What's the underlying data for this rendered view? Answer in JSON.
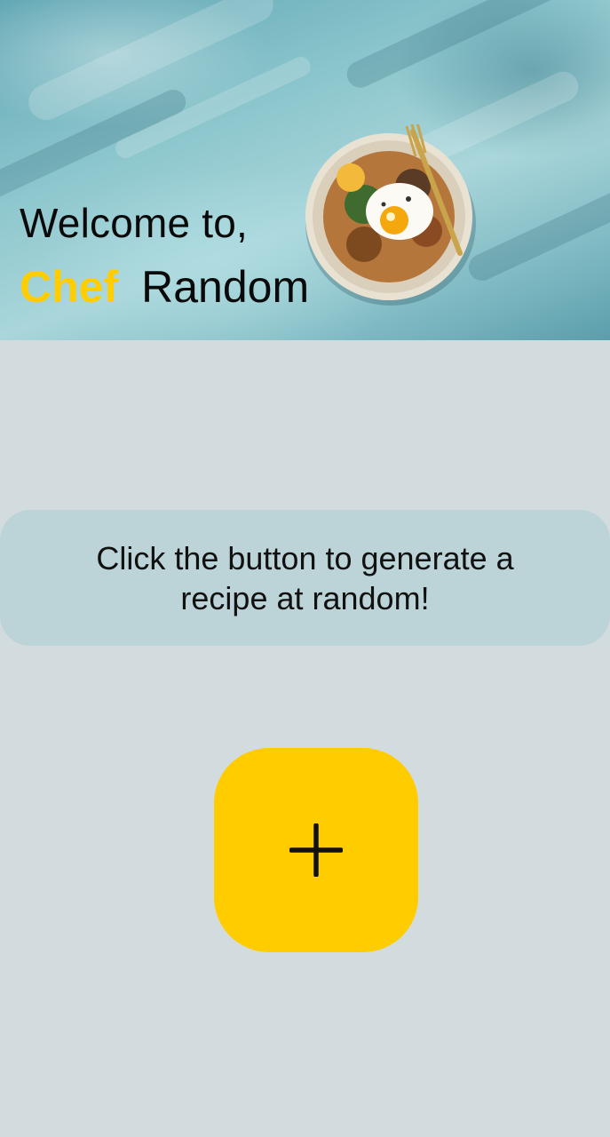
{
  "header": {
    "welcome": "Welcome to,",
    "brand_highlight": "Chef",
    "brand_rest": "Random",
    "image": "food-bowl-on-teal-background"
  },
  "info": {
    "text": "Click the button to generate a recipe at random!"
  },
  "action": {
    "icon": "plus-icon"
  },
  "colors": {
    "accent": "#ffcc00",
    "background": "#d2dcdf",
    "card": "#bcd4d7"
  }
}
